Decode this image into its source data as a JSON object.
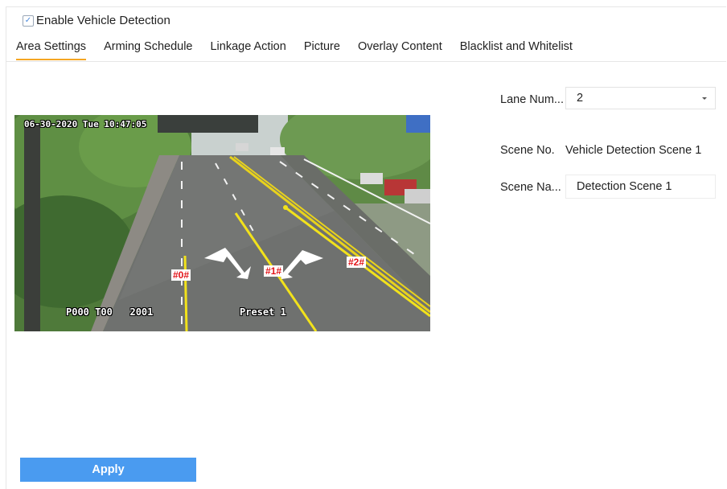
{
  "enable_detection": {
    "label": "Enable Vehicle Detection",
    "checked": true
  },
  "tabs": [
    {
      "label": "Area Settings",
      "active": true
    },
    {
      "label": "Arming Schedule",
      "active": false
    },
    {
      "label": "Linkage Action",
      "active": false
    },
    {
      "label": "Picture",
      "active": false
    },
    {
      "label": "Overlay Content",
      "active": false
    },
    {
      "label": "Blacklist and Whitelist",
      "active": false
    }
  ],
  "video": {
    "timestamp": "06-30-2020 Tue 10:47:05",
    "osd_left": "P000 T00   2001",
    "osd_preset": "Preset 1",
    "lane_tags": [
      "#0#",
      "#1#",
      "#2#"
    ]
  },
  "settings": {
    "lane_number_label": "Lane Num...",
    "lane_number_value": "2",
    "scene_no_label": "Scene No.",
    "scene_no_value": "Vehicle Detection Scene 1",
    "scene_name_label": "Scene Na...",
    "scene_name_value": "Detection Scene 1"
  },
  "apply_label": "Apply",
  "colors": {
    "accent_tab": "#f5a623",
    "apply_button": "#4a9bf0",
    "lane_line": "#f2e21b",
    "lane_tag_text": "#e3151a"
  }
}
